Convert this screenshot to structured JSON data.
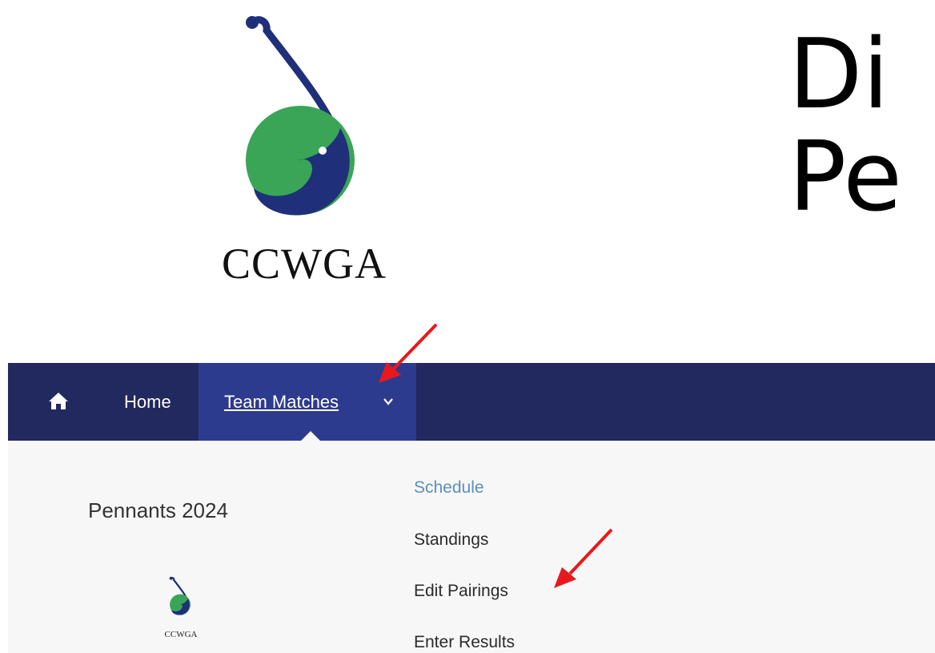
{
  "header": {
    "logo_text": "CCWGA",
    "title_line1": "Di",
    "title_line2": "Pe"
  },
  "nav": {
    "home_icon": "home-icon",
    "home_label": "Home",
    "team_matches_label": "Team Matches",
    "team_matches_chevron": "chevron-down-icon"
  },
  "dropdown": {
    "section_title": "Pennants 2024",
    "logo_text": "CCWGA",
    "items": [
      {
        "label": "Schedule"
      },
      {
        "label": "Standings"
      },
      {
        "label": "Edit Pairings"
      },
      {
        "label": "Enter Results"
      }
    ]
  },
  "colors": {
    "navbar": "#22295e",
    "nav_active": "#2d3b8e",
    "dropdown_bg": "#f7f7f7",
    "active_link": "#5a8fbd",
    "logo_navy": "#1f2f7a",
    "logo_green": "#3aa556",
    "annotation_arrow": "#e8191c"
  }
}
